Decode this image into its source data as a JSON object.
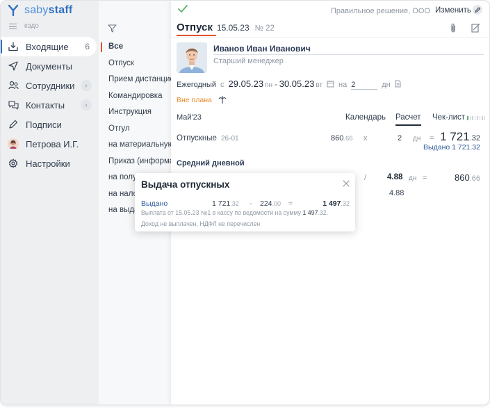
{
  "app": {
    "logo_text_light": "saby",
    "logo_text_bold": "staff",
    "subtitle": "кэдо",
    "accent_color": "#2f6fc0",
    "highlight_color": "#e4512b"
  },
  "sidebar": {
    "items": [
      {
        "label": "Входящие",
        "icon": "inbox-download-icon",
        "badge": "6",
        "active": true
      },
      {
        "label": "Документы",
        "icon": "paper-plane-icon"
      },
      {
        "label": "Сотрудники",
        "icon": "users-icon",
        "has_submenu": true
      },
      {
        "label": "Контакты",
        "icon": "chat-bubbles-icon",
        "has_submenu": true
      },
      {
        "label": "Подписи",
        "icon": "pen-icon"
      },
      {
        "label": "Петрова И.Г.",
        "icon": "user-avatar"
      },
      {
        "label": "Настройки",
        "icon": "gear-icon"
      }
    ],
    "chevron": "›"
  },
  "filters": {
    "items": [
      "Все",
      "Отпуск",
      "Прием дистанционного",
      "Командировка",
      "Инструкция",
      "Отгул",
      "на материальную",
      "Приказ (информация)",
      "на полу",
      "на нало",
      "на выда"
    ]
  },
  "document": {
    "organization": "Правильное решение, ООО",
    "edit_label": "Изменить",
    "title": "Отпуск",
    "date": "15.05.23",
    "number": "№ 22",
    "employee": {
      "name": "Иванов Иван Иванович",
      "position": "Старший менеджер"
    },
    "period": {
      "type": "Ежегодный",
      "from_label": "с",
      "from": "29.05.23",
      "from_dow": "пн",
      "dash": "-",
      "to": "30.05.23",
      "to_dow": "вт",
      "for_label": "на",
      "days": "2",
      "days_unit": "дн"
    },
    "extra_label": "Вне плана",
    "month": "Май'23",
    "tabs": [
      "Календарь",
      "Расчет",
      "Чек-лист"
    ],
    "selected_tab": "Расчет",
    "payment": {
      "label": "Отпускные",
      "code": "26-01",
      "rate_int": "860",
      "rate_dec": ".66",
      "times": "x",
      "qty": "2",
      "unit": "дн",
      "equals": "=",
      "sum_int": "1 721",
      "sum_dec": ".32",
      "paid": "Выдано 1 721.32"
    },
    "average": {
      "title": "Средний дневной",
      "slash": "/",
      "value": "4.88",
      "unit": "дн",
      "equals": "=",
      "result_int": "860",
      "result_dec": ".66",
      "sub_value": "4.88"
    }
  },
  "popup": {
    "title": "Выдача отпускных",
    "row_label": "Выдано",
    "amount_int": "1 721",
    "amount_dec": ".32",
    "minus": "-",
    "deduct_int": "224",
    "deduct_dec": ".00",
    "equals": "=",
    "total_int": "1 497",
    "total_dec": ".32",
    "note1_prefix": "Выплата от 15.05.23 №1 в кассу по ведомости на сумму",
    "note1_amount": "1 497",
    "note1_dec": ".32.",
    "note2": "Доход не выплачен, НДФЛ не перечислен"
  }
}
